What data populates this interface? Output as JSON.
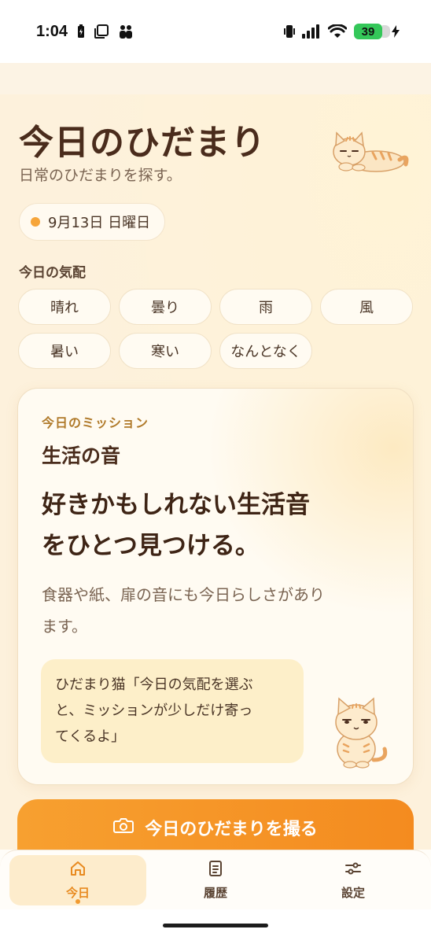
{
  "status_bar": {
    "time": "1:04",
    "battery": "39",
    "icons": [
      "battery-charging-icon",
      "copy-icon",
      "people-icon",
      "vibrate-icon",
      "signal-icon",
      "wifi-icon",
      "charging-bolt-icon"
    ]
  },
  "header": {
    "title": "今日のひだまり",
    "subtitle": "日常のひだまりを探す。"
  },
  "date": "9月13日 日曜日",
  "mood": {
    "label": "今日の気配",
    "options": [
      "晴れ",
      "曇り",
      "雨",
      "風",
      "暑い",
      "寒い",
      "なんとなく"
    ]
  },
  "mission": {
    "label": "今日のミッション",
    "theme": "生活の音",
    "main_line1": "好きかもしれない生活音",
    "main_line2": "をひとつ見つける。",
    "desc_line1": "食器や紙、扉の音にも今日らしさがあり",
    "desc_line2": "ます。",
    "speech_line1": "ひだまり猫「今日の気配を選ぶ",
    "speech_line2": "と、ミッションが少しだけ寄っ",
    "speech_line3": "てくるよ」"
  },
  "cta": {
    "label": "今日のひだまりを撮る"
  },
  "nav": {
    "items": [
      {
        "label": "今日",
        "icon": "home-icon",
        "active": true
      },
      {
        "label": "履歴",
        "icon": "list-icon",
        "active": false
      },
      {
        "label": "設定",
        "icon": "sliders-icon",
        "active": false
      }
    ]
  },
  "colors": {
    "accent": "#f48b1f",
    "background": "#fdf2de",
    "text": "#4a2c1c"
  }
}
